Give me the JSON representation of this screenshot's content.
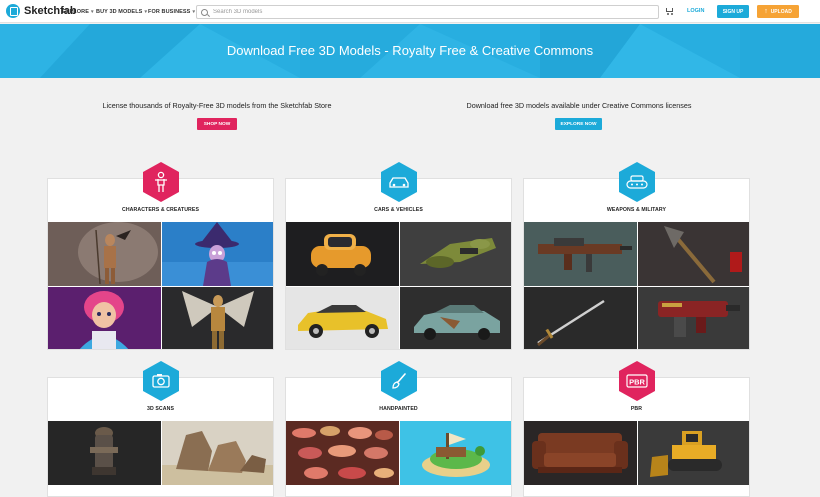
{
  "brand": {
    "name": "Sketchfab"
  },
  "nav": {
    "items": [
      {
        "label": "EXPLORE"
      },
      {
        "label": "BUY 3D MODELS"
      },
      {
        "label": "FOR BUSINESS"
      }
    ],
    "search_placeholder": "Search 3D models",
    "login_label": "LOGIN",
    "signup_label": "SIGN UP",
    "upload_label": "UPLOAD"
  },
  "hero": {
    "title": "Download Free 3D Models - Royalty Free & Creative Commons"
  },
  "intro": {
    "store_text": "License thousands of Royalty-Free 3D models from the Sketchfab Store",
    "store_button": "SHOP NOW",
    "cc_text": "Download free 3D models available under Creative Commons licenses",
    "cc_button": "EXPLORE NOW"
  },
  "categories": [
    {
      "label": "CHARACTERS & CREATURES",
      "icon": "person-icon",
      "color": "#e0245e"
    },
    {
      "label": "CARS & VEHICLES",
      "icon": "car-icon",
      "color": "#1caad9"
    },
    {
      "label": "WEAPONS & MILITARY",
      "icon": "tank-icon",
      "color": "#1caad9"
    },
    {
      "label": "3D SCANS",
      "icon": "camera-icon",
      "color": "#1caad9"
    },
    {
      "label": "HANDPAINTED",
      "icon": "brush-icon",
      "color": "#1caad9"
    },
    {
      "label": "PBR",
      "icon": "pbr-icon",
      "color": "#e0245e"
    }
  ],
  "colors": {
    "accent": "#1caad9",
    "pink": "#e0245e",
    "orange": "#f6a335",
    "hero": "#28aee0"
  }
}
